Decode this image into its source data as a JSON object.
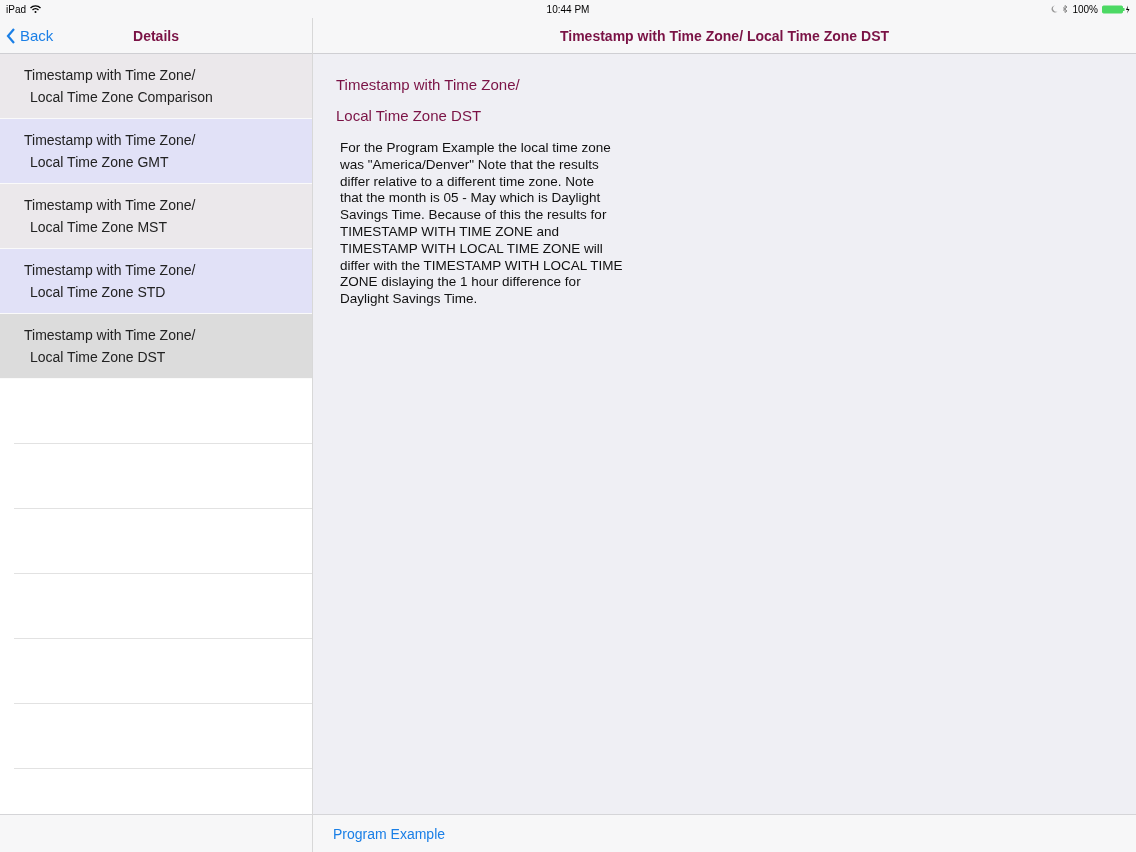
{
  "status_bar": {
    "device": "iPad",
    "time": "10:44 PM",
    "battery": "100%"
  },
  "master": {
    "back": "Back",
    "title": "Details",
    "items": [
      {
        "line1": "Timestamp with Time Zone/",
        "line2": "Local Time Zone Comparison",
        "selected": false
      },
      {
        "line1": "Timestamp with Time Zone/",
        "line2": "Local Time Zone GMT",
        "selected": false
      },
      {
        "line1": "Timestamp with Time Zone/",
        "line2": "Local Time Zone MST",
        "selected": false
      },
      {
        "line1": "Timestamp with Time Zone/",
        "line2": "Local Time Zone STD",
        "selected": false
      },
      {
        "line1": "Timestamp with Time Zone/",
        "line2": "Local Time Zone DST",
        "selected": true
      }
    ]
  },
  "detail": {
    "title": "Timestamp with Time Zone/ Local Time Zone DST",
    "heading1": "Timestamp with Time Zone/",
    "heading2": "Local Time Zone DST",
    "body": [
      "For the Program Example the local time zone",
      "was \"America/Denver\"  Note that the results",
      "differ relative to a different time zone.  Note",
      "that the month is 05 - May which is Daylight",
      "Savings Time.  Because of this the results for",
      "TIMESTAMP WITH TIME ZONE and",
      "TIMESTAMP WITH LOCAL TIME ZONE will",
      "differ with the TIMESTAMP WITH LOCAL TIME",
      "ZONE dislaying the 1 hour difference for",
      "Daylight Savings Time."
    ],
    "toolbar_link": "Program Example"
  }
}
